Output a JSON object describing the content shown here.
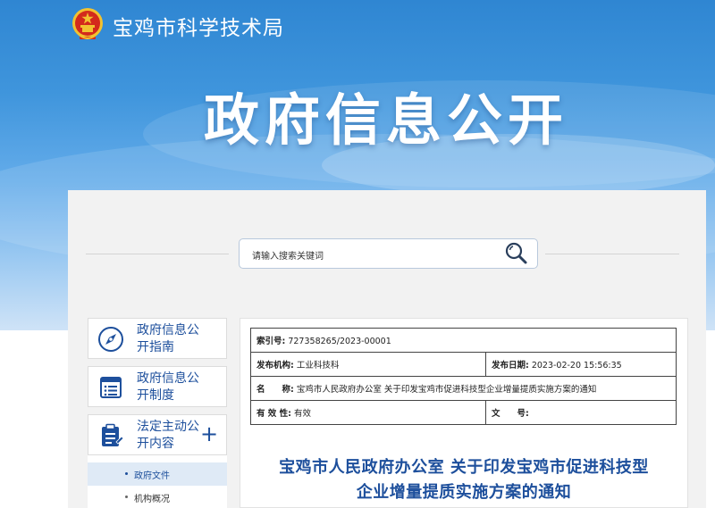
{
  "header": {
    "site_name": "宝鸡市科学技术局",
    "banner_title": "政府信息公开"
  },
  "search": {
    "placeholder": "请输入搜索关键词"
  },
  "sidebar": {
    "items": [
      {
        "label": "政府信息公开指南",
        "icon": "compass-icon"
      },
      {
        "label": "政府信息公开制度",
        "icon": "list-icon"
      },
      {
        "label": "法定主动公开内容",
        "icon": "document-icon",
        "expand": "+"
      }
    ],
    "subitems": [
      {
        "label": "政府文件",
        "active": true
      },
      {
        "label": "机构概况",
        "active": false
      }
    ]
  },
  "info_table": {
    "index_label": "索引号:",
    "index_value": "727358265/2023-00001",
    "publisher_label": "发布机构:",
    "publisher_value": "工业科技科",
    "date_label": "发布日期:",
    "date_value": "2023-02-20 15:56:35",
    "name_label": "名　　称:",
    "name_value": "宝鸡市人民政府办公室 关于印发宝鸡市促进科技型企业增量提质实施方案的通知",
    "validity_label": "有 效 性:",
    "validity_value": "有效",
    "docno_label": "文　　号:",
    "docno_value": ""
  },
  "document": {
    "title_line1": "宝鸡市人民政府办公室 关于印发宝鸡市促进科技型",
    "title_line2": "企业增量提质实施方案的通知"
  },
  "colors": {
    "brand_blue": "#1d4f9c",
    "banner_top": "#2f86d2",
    "emblem_red": "#d32a1c",
    "emblem_gold": "#f2c230"
  }
}
